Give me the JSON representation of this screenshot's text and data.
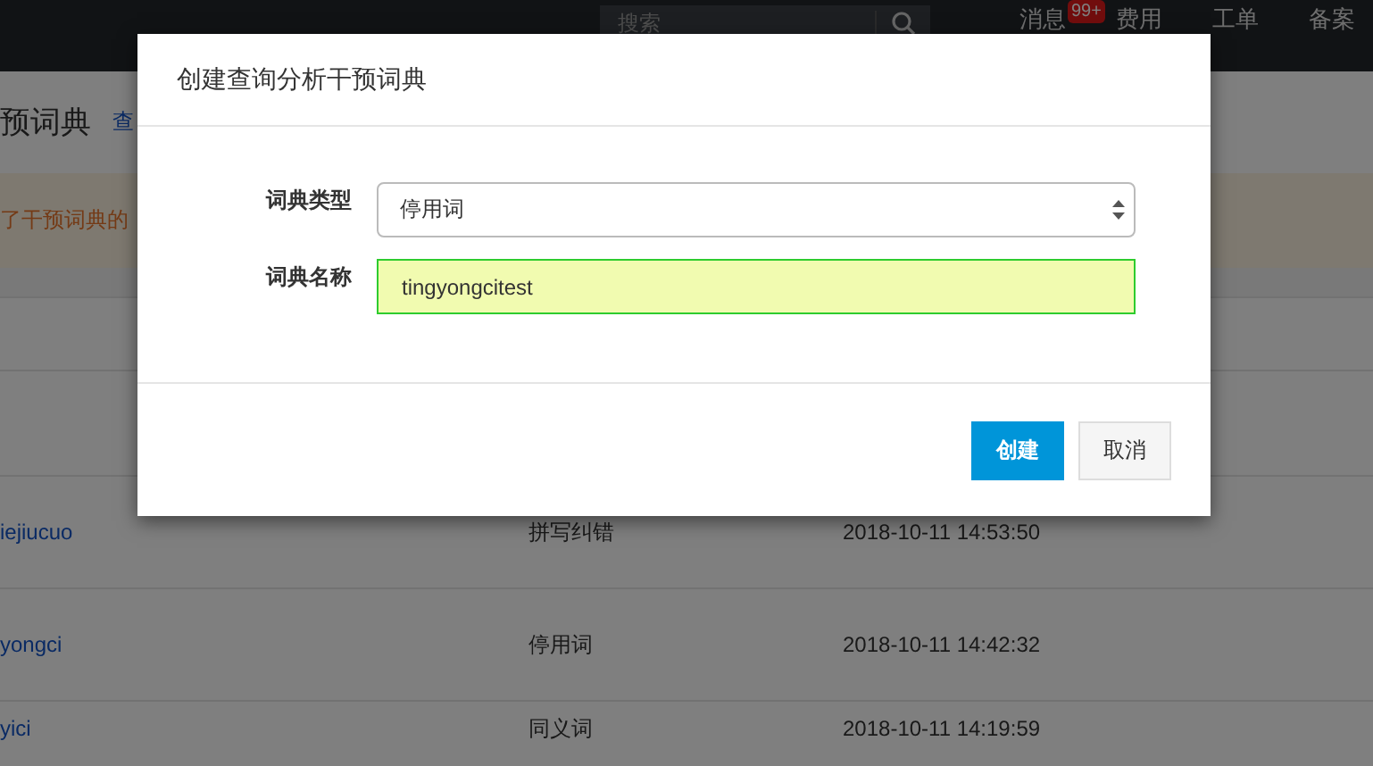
{
  "topbar": {
    "search": {
      "placeholder": "搜索"
    },
    "nav": [
      {
        "label": "消息",
        "badge": "99+"
      },
      {
        "label": "费用"
      },
      {
        "label": "工单"
      },
      {
        "label": "备案"
      }
    ]
  },
  "page": {
    "title": "预词典",
    "link": "查",
    "notice": "了干预词典的",
    "rows": [
      {
        "name": "iejiucuo",
        "type": "拼写纠错",
        "time": "2018-10-11 14:53:50"
      },
      {
        "name": "yongci",
        "type": "停用词",
        "time": "2018-10-11 14:42:32"
      },
      {
        "name": "yici",
        "type": "同义词",
        "time": "2018-10-11 14:19:59"
      }
    ]
  },
  "dialog": {
    "title": "创建查询分析干预词典",
    "fields": [
      {
        "kind": "select",
        "label": "词典类型",
        "value": "停用词"
      },
      {
        "kind": "text",
        "label": "词典名称",
        "value": "tingyongcitest"
      }
    ],
    "buttons": [
      {
        "label": "创建",
        "primary": true
      },
      {
        "label": "取消",
        "primary": false
      }
    ]
  }
}
